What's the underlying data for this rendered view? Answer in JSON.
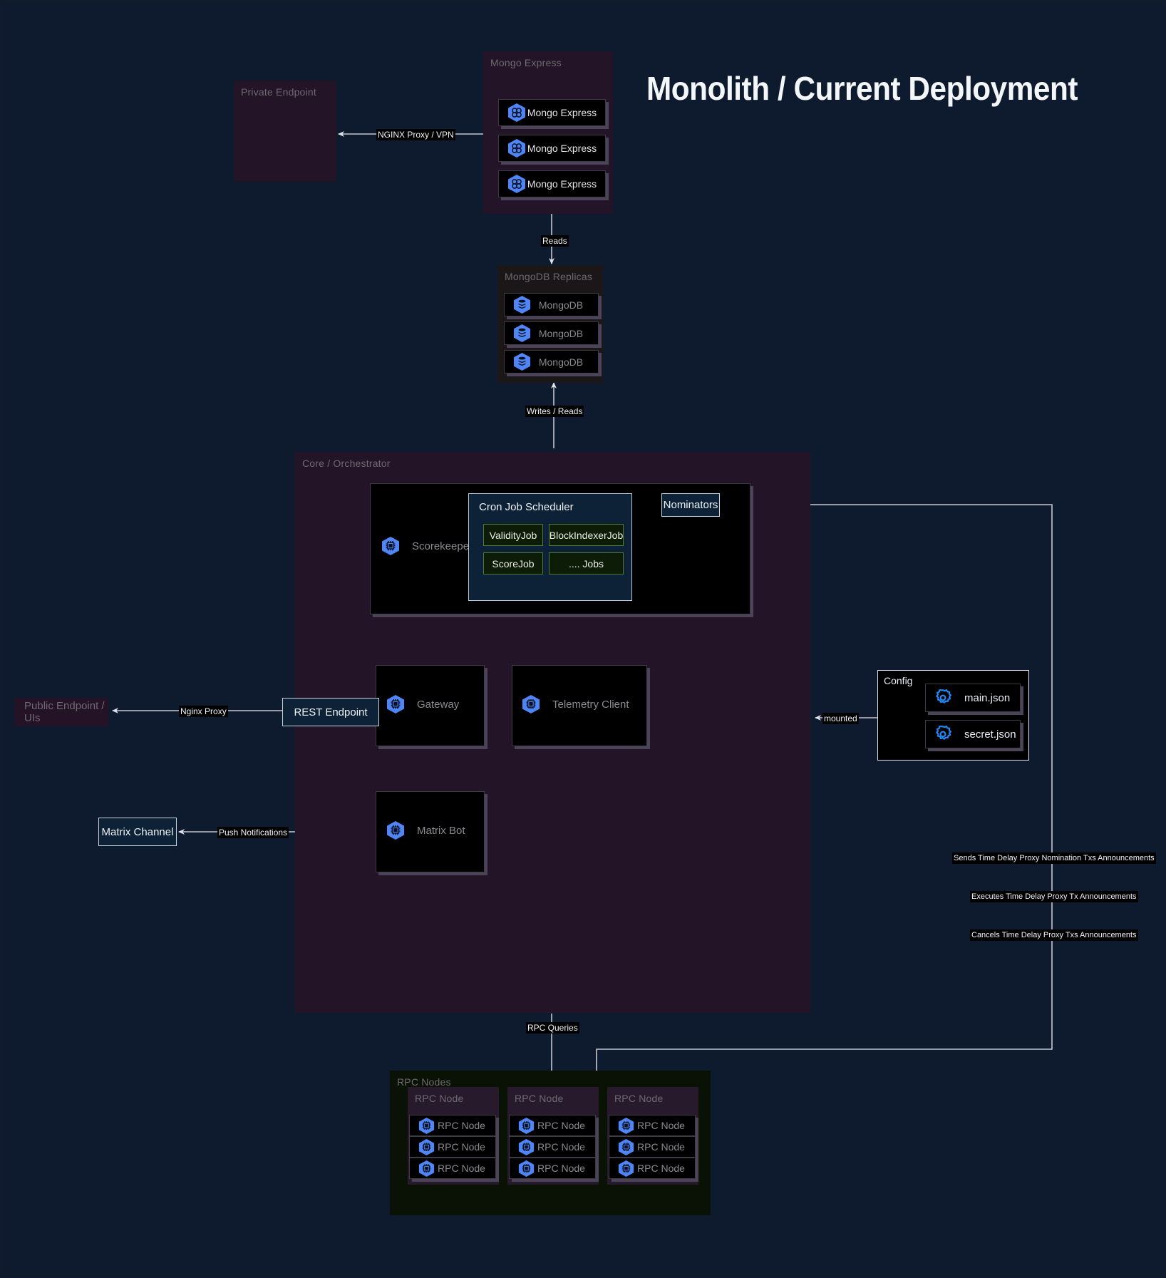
{
  "title": "Monolith / Current Deployment",
  "colors": {
    "canvas": "#0e1b2e",
    "group_purple": "#231427",
    "group_dark": "#1b1618",
    "group_green": "#0a1206",
    "group_node": "#271a2c",
    "accent_blue": "#4f86f7",
    "box_blue_bg": "#0d2236",
    "job_green_border": "#4e7a33",
    "edge_stroke": "#c7c7cf"
  },
  "groups": {
    "mongo_express": {
      "title": "Mongo Express"
    },
    "mongodb_replicas": {
      "title": "MongoDB Replicas"
    },
    "core": {
      "title": "Core / Orchestrator"
    },
    "rpc_nodes": {
      "title": "RPC Nodes"
    }
  },
  "endpoints": {
    "private": "Private Endpoint",
    "public": "Public Endpoint / UIs"
  },
  "mongo_express_nodes": [
    {
      "label": "Mongo Express",
      "icon": "mongo-express-icon"
    },
    {
      "label": "Mongo Express",
      "icon": "mongo-express-icon"
    },
    {
      "label": "Mongo Express",
      "icon": "mongo-express-icon"
    }
  ],
  "mongodb_nodes": [
    {
      "label": "MongoDB",
      "icon": "mongodb-icon"
    },
    {
      "label": "MongoDB",
      "icon": "mongodb-icon"
    },
    {
      "label": "MongoDB",
      "icon": "mongodb-icon"
    }
  ],
  "core": {
    "scorekeeper": {
      "label": "Scorekeeper",
      "icon": "cpu-chip-icon"
    },
    "nominators": {
      "label": "Nominators"
    },
    "cron": {
      "title": "Cron Job Scheduler",
      "jobs": [
        {
          "label": "ValidityJob"
        },
        {
          "label": "BlockIndexerJob"
        },
        {
          "label": "ScoreJob"
        },
        {
          "label": ".... Jobs"
        }
      ]
    },
    "rest_endpoint": {
      "label": "REST Endpoint"
    },
    "gateway": {
      "label": "Gateway",
      "icon": "cpu-chip-icon"
    },
    "telemetry": {
      "label": "Telemetry Client",
      "icon": "cpu-chip-icon"
    },
    "matrix_bot": {
      "label": "Matrix Bot",
      "icon": "cpu-chip-icon"
    }
  },
  "matrix_channel": {
    "label": "Matrix Channel"
  },
  "config": {
    "title": "Config",
    "files": [
      {
        "label": "main.json",
        "icon": "gear-icon"
      },
      {
        "label": "secret.json",
        "icon": "gear-icon"
      }
    ]
  },
  "rpc_groups": [
    {
      "title": "RPC Node",
      "nodes": [
        {
          "label": "RPC Node",
          "icon": "cpu-chip-icon"
        },
        {
          "label": "RPC Node",
          "icon": "cpu-chip-icon"
        },
        {
          "label": "RPC Node",
          "icon": "cpu-chip-icon"
        }
      ]
    },
    {
      "title": "RPC Node",
      "nodes": [
        {
          "label": "RPC Node",
          "icon": "cpu-chip-icon"
        },
        {
          "label": "RPC Node",
          "icon": "cpu-chip-icon"
        },
        {
          "label": "RPC Node",
          "icon": "cpu-chip-icon"
        }
      ]
    },
    {
      "title": "RPC Node",
      "nodes": [
        {
          "label": "RPC Node",
          "icon": "cpu-chip-icon"
        },
        {
          "label": "RPC Node",
          "icon": "cpu-chip-icon"
        },
        {
          "label": "RPC Node",
          "icon": "cpu-chip-icon"
        }
      ]
    }
  ],
  "edges": {
    "nginx_proxy_vpn": "NGINX Proxy / VPN",
    "reads": "Reads",
    "writes_reads": "Writes / Reads",
    "nginx_proxy": "Nginx Proxy",
    "push_notifications": "Push Notifications",
    "mounted": "mounted",
    "rpc_queries": "RPC Queries",
    "sends_nomination": "Sends Time Delay Proxy Nomination Txs Announcements",
    "executes_tx": "Executes Time Delay Proxy Tx Announcements",
    "cancels_tx": "Cancels Time Delay Proxy Txs Announcements"
  }
}
